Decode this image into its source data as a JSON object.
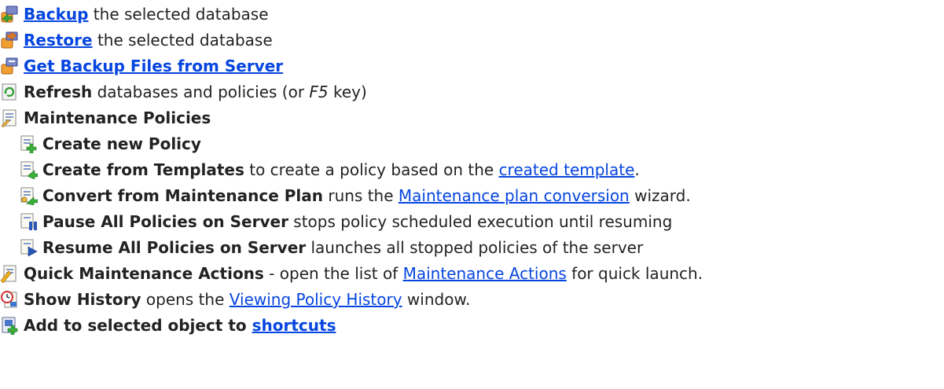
{
  "items": [
    {
      "link": "Backup",
      "rest": " the selected database"
    },
    {
      "link": "Restore",
      "rest": " the selected database"
    },
    {
      "link": "Get Backup Files from Server"
    },
    {
      "bold": "Refresh",
      "rest": " databases and policies (or ",
      "italic": "F5",
      "tail": " key)"
    },
    {
      "bold": "Maintenance Policies"
    },
    {
      "bold": "Create new Policy"
    },
    {
      "bold": "Create from Templates",
      "rest": " to create a policy based on the ",
      "link": "created template",
      "tail": "."
    },
    {
      "bold": "Convert from Maintenance Plan",
      "rest": " runs the ",
      "link": "Maintenance plan conversion",
      "tail": " wizard."
    },
    {
      "bold": "Pause All Policies on Server",
      "rest": " stops policy scheduled execution until resuming"
    },
    {
      "bold": "Resume All Policies on Server",
      "rest": " launches all stopped policies of the server"
    },
    {
      "bold": "Quick Maintenance Actions",
      "rest": " - open the list of ",
      "link": "Maintenance Actions",
      "tail": " for quick launch."
    },
    {
      "bold": "Show History",
      "rest": " opens the ",
      "link": "Viewing Policy History",
      "tail": " window."
    },
    {
      "bold": "Add to selected object to ",
      "link": "shortcuts"
    }
  ],
  "icons": [
    "backup-icon",
    "restore-icon",
    "get-backup-files-icon",
    "refresh-icon",
    "maintenance-policies-icon",
    "create-policy-icon",
    "create-from-templates-icon",
    "convert-plan-icon",
    "pause-policies-icon",
    "resume-policies-icon",
    "quick-actions-icon",
    "history-icon",
    "add-shortcut-icon"
  ]
}
